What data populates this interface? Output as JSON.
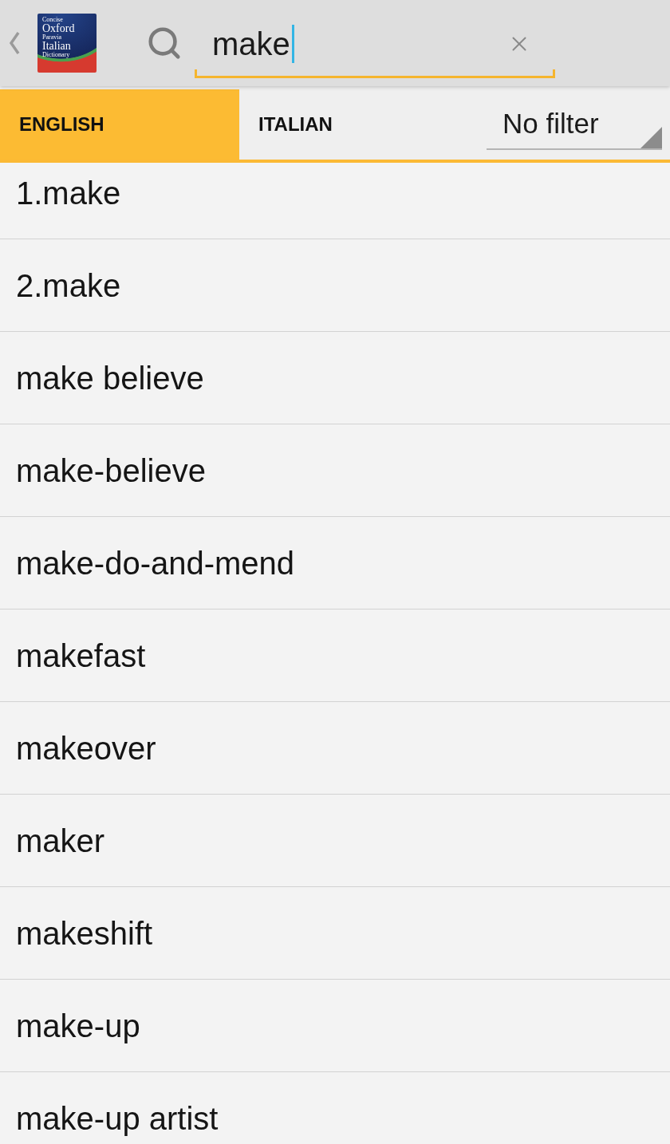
{
  "search": {
    "value": "make",
    "focused": true
  },
  "logo": {
    "lines": [
      "Concise",
      "Oxford",
      "Paravia",
      "Italian",
      "Dictionary"
    ]
  },
  "tabs": [
    {
      "label": "ENGLISH",
      "selected": true
    },
    {
      "label": "ITALIAN",
      "selected": false
    }
  ],
  "filter": {
    "value": "No filter"
  },
  "entries": [
    "1.make",
    "2.make",
    "make believe",
    "make-believe",
    "make-do-and-mend",
    "makefast",
    "makeover",
    "maker",
    "makeshift",
    "make-up",
    "make-up artist"
  ]
}
